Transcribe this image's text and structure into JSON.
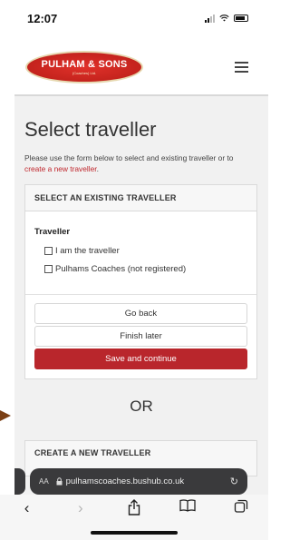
{
  "status_bar": {
    "time": "12:07"
  },
  "header": {
    "logo_text": "PULHAM & SONS",
    "logo_subtext": "(Coaches) Ltd.",
    "menu_icon": "hamburger-menu-icon"
  },
  "page": {
    "title": "Select traveller",
    "intro_text": "Please use the form below to select and existing traveller or to ",
    "intro_link": "create a new traveller",
    "intro_end": "."
  },
  "existing_card": {
    "header": "SELECT AN EXISTING TRAVELLER",
    "field_label": "Traveller",
    "options": [
      {
        "label": "I am the traveller",
        "checked": false
      },
      {
        "label": "Pulhams Coaches (not registered)",
        "checked": false
      }
    ],
    "buttons": {
      "go_back": "Go back",
      "finish_later": "Finish later",
      "save_continue": "Save and continue"
    },
    "accent_color": "#b9262c"
  },
  "or_text": "OR",
  "new_card": {
    "header": "CREATE A NEW TRAVELLER"
  },
  "browser": {
    "aa_label": "AA",
    "url": "pulhamscoaches.bushub.co.uk",
    "toolbar_icons": [
      "back-icon",
      "forward-icon",
      "share-icon",
      "bookmarks-icon",
      "tabs-icon"
    ]
  }
}
